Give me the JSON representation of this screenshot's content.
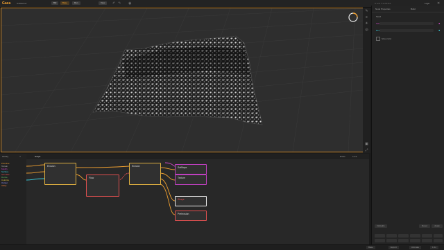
{
  "app": {
    "logo": "Gaea",
    "project": "Untitled.tor"
  },
  "toolbar": {
    "btn1": "Bld",
    "btn2": "Bake",
    "btn3": "Run",
    "btn4": "View"
  },
  "topright": {
    "coords": "X:-2.3  Y:1.4  Z:0.0",
    "account": "Login"
  },
  "properties": {
    "tabs": [
      "Node Properties",
      "Build"
    ],
    "rows": [
      {
        "label": "Seed",
        "color": "#aaaaaa"
      },
      {
        "label": "Size",
        "color": "#d048c8"
      },
      {
        "label": "Detail",
        "color": "#3ad0e0"
      }
    ],
    "checkbox_label": "Show Grid",
    "bottom_buttons": [
      "Defaults",
      "Reset",
      "Apply"
    ]
  },
  "graph": {
    "tab": "Graph",
    "right_controls": [
      "Erase",
      "Lock"
    ],
    "nodes": {
      "erosion1": "Erosion",
      "flow": "Flow",
      "erosion2": "Erosion",
      "satmaps": "SatMaps",
      "texture": "Texture",
      "shape": "Shape",
      "prehrosion": "Prehrosion"
    }
  },
  "library": {
    "title": "Library",
    "categories": [
      "Primitive",
      "Terrain",
      "Modify",
      "Surface",
      "Simulate",
      "Derive",
      "Colorize",
      "Output",
      "Utility"
    ],
    "colors": [
      "#f0a030",
      "#b0b0b0",
      "#c040c0",
      "#3ad0e0",
      "#e05050",
      "#60c060",
      "#e0c040",
      "#9090ff",
      "#f08040"
    ]
  },
  "status": {
    "items": [
      "Bake",
      "Export",
      "Animate"
    ],
    "zoom": "1.0x"
  }
}
